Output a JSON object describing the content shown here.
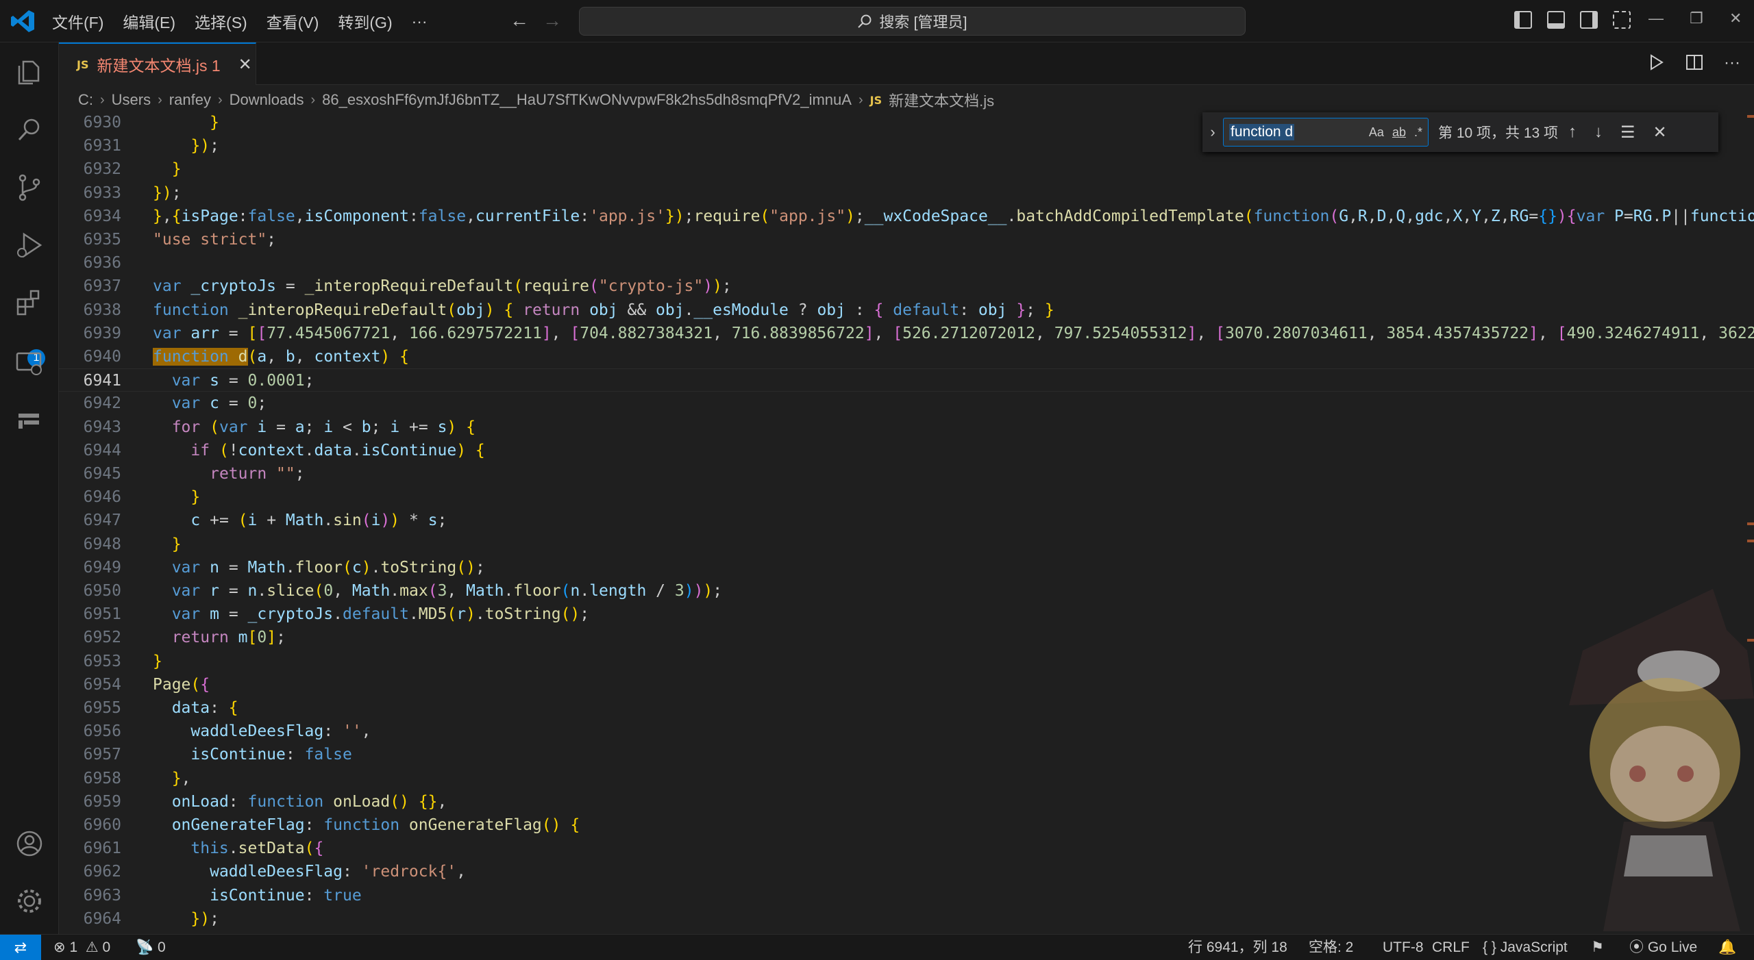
{
  "menu": [
    "文件(F)",
    "编辑(E)",
    "选择(S)",
    "查看(V)",
    "转到(G)",
    "···"
  ],
  "command_center": "搜索 [管理员]",
  "tab": {
    "lang": "JS",
    "name": "新建文本文档.js",
    "problems": "1",
    "close": "✕"
  },
  "breadcrumb": [
    "C:",
    "Users",
    "ranfey",
    "Downloads",
    "86_esxoshFf6ymJfJ6bnTZ__HaU7SfTKwONvvpwF8k2hs5dh8smqPfV2_imnuA",
    "新建文本文档.js"
  ],
  "breadcrumb_js": "JS",
  "find": {
    "query": "function d",
    "case": "Aa",
    "word": "ab",
    "regex": ".*",
    "count": "第 10 项，共 13 项"
  },
  "activity_badge": "1",
  "status": {
    "errors": "1",
    "warnings": "0",
    "ports": "0",
    "position": "行 6941，列 18",
    "spaces": "空格: 2",
    "encoding": "UTF-8",
    "eol": "CRLF",
    "language": "JavaScript",
    "golive": "Go Live"
  },
  "code": [
    {
      "ln": "6930",
      "text": "      }"
    },
    {
      "ln": "6931",
      "text": "    });"
    },
    {
      "ln": "6932",
      "text": "  }"
    },
    {
      "ln": "6933",
      "text": "});"
    },
    {
      "ln": "6934",
      "text": "},{isPage:false,isComponent:false,currentFile:'app.js'});require(\"app.js\");__wxCodeSpace__.batchAddCompiledTemplate(function(G,R,D,Q,gdc,X,Y,Z,RG={}){var P=RG.P||functio"
    },
    {
      "ln": "6935",
      "text": "\"use strict\";"
    },
    {
      "ln": "6936",
      "text": ""
    },
    {
      "ln": "6937",
      "text": "var _cryptoJs = _interopRequireDefault(require(\"crypto-js\"));"
    },
    {
      "ln": "6938",
      "text": "function _interopRequireDefault(obj) { return obj && obj.__esModule ? obj : { default: obj }; }"
    },
    {
      "ln": "6939",
      "text": "var arr = [[77.4545067721, 166.6297572211], [704.8827384321, 716.8839856722], [526.2712072012, 797.5254055312], [3070.2807034611, 3854.4357435722], [490.3246274911, 3622"
    },
    {
      "ln": "6940",
      "text": "function d(a, b, context) {"
    },
    {
      "ln": "6941",
      "text": "  var s = 0.0001;"
    },
    {
      "ln": "6942",
      "text": "  var c = 0;"
    },
    {
      "ln": "6943",
      "text": "  for (var i = a; i < b; i += s) {"
    },
    {
      "ln": "6944",
      "text": "    if (!context.data.isContinue) {"
    },
    {
      "ln": "6945",
      "text": "      return \"\";"
    },
    {
      "ln": "6946",
      "text": "    }"
    },
    {
      "ln": "6947",
      "text": "    c += (i + Math.sin(i)) * s;"
    },
    {
      "ln": "6948",
      "text": "  }"
    },
    {
      "ln": "6949",
      "text": "  var n = Math.floor(c).toString();"
    },
    {
      "ln": "6950",
      "text": "  var r = n.slice(0, Math.max(3, Math.floor(n.length / 3)));"
    },
    {
      "ln": "6951",
      "text": "  var m = _cryptoJs.default.MD5(r).toString();"
    },
    {
      "ln": "6952",
      "text": "  return m[0];"
    },
    {
      "ln": "6953",
      "text": "}"
    },
    {
      "ln": "6954",
      "text": "Page({"
    },
    {
      "ln": "6955",
      "text": "  data: {"
    },
    {
      "ln": "6956",
      "text": "    waddleDeesFlag: '',"
    },
    {
      "ln": "6957",
      "text": "    isContinue: false"
    },
    {
      "ln": "6958",
      "text": "  },"
    },
    {
      "ln": "6959",
      "text": "  onLoad: function onLoad() {},"
    },
    {
      "ln": "6960",
      "text": "  onGenerateFlag: function onGenerateFlag() {"
    },
    {
      "ln": "6961",
      "text": "    this.setData({"
    },
    {
      "ln": "6962",
      "text": "      waddleDeesFlag: 'redrock{',"
    },
    {
      "ln": "6963",
      "text": "      isContinue: true"
    },
    {
      "ln": "6964",
      "text": "    });"
    }
  ]
}
